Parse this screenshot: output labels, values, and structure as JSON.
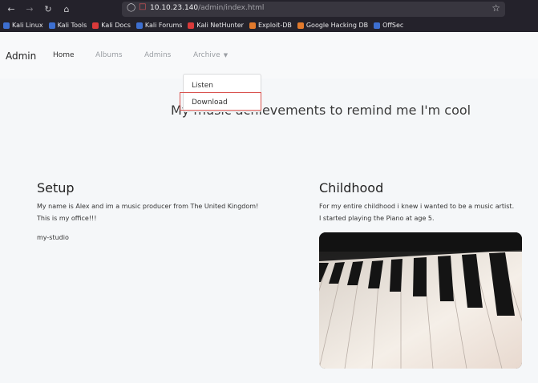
{
  "browser": {
    "url_host": "10.10.23.140",
    "url_path": "/admin/index.html",
    "bookmarks": [
      {
        "label": "Kali Linux",
        "color": "#3d6fd0"
      },
      {
        "label": "Kali Tools",
        "color": "#3d6fd0"
      },
      {
        "label": "Kali Docs",
        "color": "#d93a3a"
      },
      {
        "label": "Kali Forums",
        "color": "#3d6fd0"
      },
      {
        "label": "Kali NetHunter",
        "color": "#d93a3a"
      },
      {
        "label": "Exploit-DB",
        "color": "#e27a2c"
      },
      {
        "label": "Google Hacking DB",
        "color": "#e27a2c"
      },
      {
        "label": "OffSec",
        "color": "#3d6fd0"
      }
    ]
  },
  "navbar": {
    "brand": "Admin",
    "links": [
      "Home",
      "Albums",
      "Admins",
      "Archive"
    ]
  },
  "dropdown": {
    "items": [
      "Listen",
      "Download"
    ],
    "highlight_color": "#d9534f"
  },
  "main": {
    "headline": "My music achievements to remind me I'm cool",
    "setup": {
      "title": "Setup",
      "text_line1": "My name is Alex and im a music producer from The United Kingdom!",
      "text_line2": "This is my office!!!",
      "caption": "my-studio"
    },
    "childhood": {
      "title": "Childhood",
      "text_line1": "For my entire childhood i knew i wanted to be a music artist.",
      "text_line2": "I started playing the Piano at age 5."
    }
  }
}
